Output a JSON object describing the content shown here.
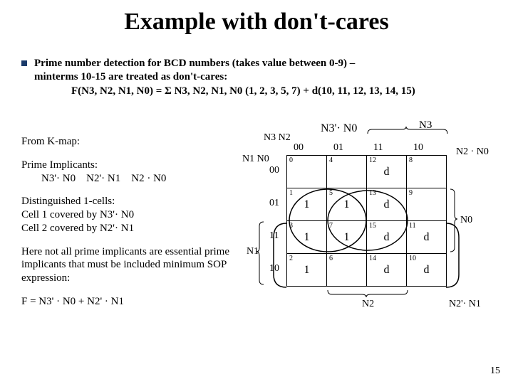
{
  "title": "Example with don't-cares",
  "intro": {
    "line1": "Prime number detection for BCD numbers (takes value between 0-9) –",
    "line2": "minterms 10-15 are treated as don't-cares:",
    "func": "F(N3, N2, N1, N0) = Σ N3, N2, N1, N0 (1, 2, 3, 5, 7)  +  d(10, 11, 12, 13, 14, 15)"
  },
  "left": {
    "from": "From K-map:",
    "pi_hdr": "Prime Implicants:",
    "pi1": "N3'· N0",
    "pi2": "N2'· N1",
    "pi3": "N2 · N0",
    "dist_hdr": "Distinguished 1-cells:",
    "dist1": "Cell 1   covered by  N3'· N0",
    "dist2": "Cell 2   covered by  N2'· N1",
    "note": "Here not all prime implicants are essential prime implicants that must be included minimum SOP expression:",
    "final": "F =   N3' · N0 +  N2' · N1"
  },
  "kmap": {
    "top_axis": "N3 N2",
    "left_axis": "N1 N0",
    "ov_top": "N3'· N0",
    "ov_n3": "N3",
    "col_hdrs": [
      "00",
      "01",
      "11",
      "10"
    ],
    "row_hdrs": [
      "00",
      "01",
      "11",
      "10"
    ],
    "cells": [
      [
        {
          "idx": "0",
          "v": ""
        },
        {
          "idx": "4",
          "v": ""
        },
        {
          "idx": "12",
          "v": "d"
        },
        {
          "idx": "8",
          "v": ""
        }
      ],
      [
        {
          "idx": "1",
          "v": "1"
        },
        {
          "idx": "5",
          "v": "1"
        },
        {
          "idx": "13",
          "v": "d"
        },
        {
          "idx": "9",
          "v": ""
        }
      ],
      [
        {
          "idx": "3",
          "v": "1"
        },
        {
          "idx": "7",
          "v": "1"
        },
        {
          "idx": "15",
          "v": "d"
        },
        {
          "idx": "11",
          "v": "d"
        }
      ],
      [
        {
          "idx": "2",
          "v": "1"
        },
        {
          "idx": "6",
          "v": ""
        },
        {
          "idx": "14",
          "v": "d"
        },
        {
          "idx": "10",
          "v": "d"
        }
      ]
    ],
    "side_n2n0": "N2 · N0",
    "side_n0": "N0",
    "side_n1": "N1",
    "bot_n2": "N2",
    "bot_right": "N2'· N1"
  },
  "page": "15"
}
